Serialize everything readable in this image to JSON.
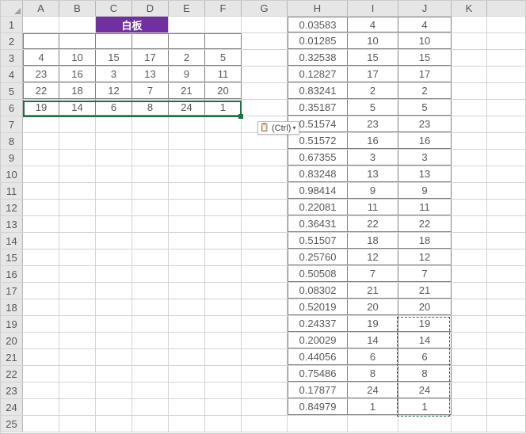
{
  "columns": [
    "A",
    "B",
    "C",
    "D",
    "E",
    "F",
    "G",
    "H",
    "I",
    "J",
    "K"
  ],
  "rowcount": 25,
  "title_cell": {
    "col": "C",
    "row": 1,
    "text": "白板",
    "colspan": 2
  },
  "grid_AF": {
    "2": [
      "",
      "",
      "",
      "",
      "",
      ""
    ],
    "3": [
      "4",
      "10",
      "15",
      "17",
      "2",
      "5"
    ],
    "4": [
      "23",
      "16",
      "3",
      "13",
      "9",
      "11"
    ],
    "5": [
      "22",
      "18",
      "12",
      "7",
      "21",
      "20"
    ],
    "6": [
      "19",
      "14",
      "6",
      "8",
      "24",
      "1"
    ]
  },
  "grid_HJ": {
    "1": [
      "0.03583",
      "4",
      "4"
    ],
    "2": [
      "0.01285",
      "10",
      "10"
    ],
    "3": [
      "0.32538",
      "15",
      "15"
    ],
    "4": [
      "0.12827",
      "17",
      "17"
    ],
    "5": [
      "0.83241",
      "2",
      "2"
    ],
    "6": [
      "0.35187",
      "5",
      "5"
    ],
    "7": [
      "0.51574",
      "23",
      "23"
    ],
    "8": [
      "0.51572",
      "16",
      "16"
    ],
    "9": [
      "0.67355",
      "3",
      "3"
    ],
    "10": [
      "0.83248",
      "13",
      "13"
    ],
    "11": [
      "0.98414",
      "9",
      "9"
    ],
    "12": [
      "0.22081",
      "11",
      "11"
    ],
    "13": [
      "0.36431",
      "22",
      "22"
    ],
    "14": [
      "0.51507",
      "18",
      "18"
    ],
    "15": [
      "0.25760",
      "12",
      "12"
    ],
    "16": [
      "0.50508",
      "7",
      "7"
    ],
    "17": [
      "0.08302",
      "21",
      "21"
    ],
    "18": [
      "0.52019",
      "20",
      "20"
    ],
    "19": [
      "0.24337",
      "19",
      "19"
    ],
    "20": [
      "0.20029",
      "14",
      "14"
    ],
    "21": [
      "0.44056",
      "6",
      "6"
    ],
    "22": [
      "0.75486",
      "8",
      "8"
    ],
    "23": [
      "0.17877",
      "24",
      "24"
    ],
    "24": [
      "0.84979",
      "1",
      "1"
    ]
  },
  "paste_ctrl": {
    "label": "(Ctrl)"
  },
  "selection": {
    "rows": [
      6
    ],
    "range": "A6:F6",
    "paste_target": "B6:F6"
  },
  "marching_range": "J19:J24"
}
